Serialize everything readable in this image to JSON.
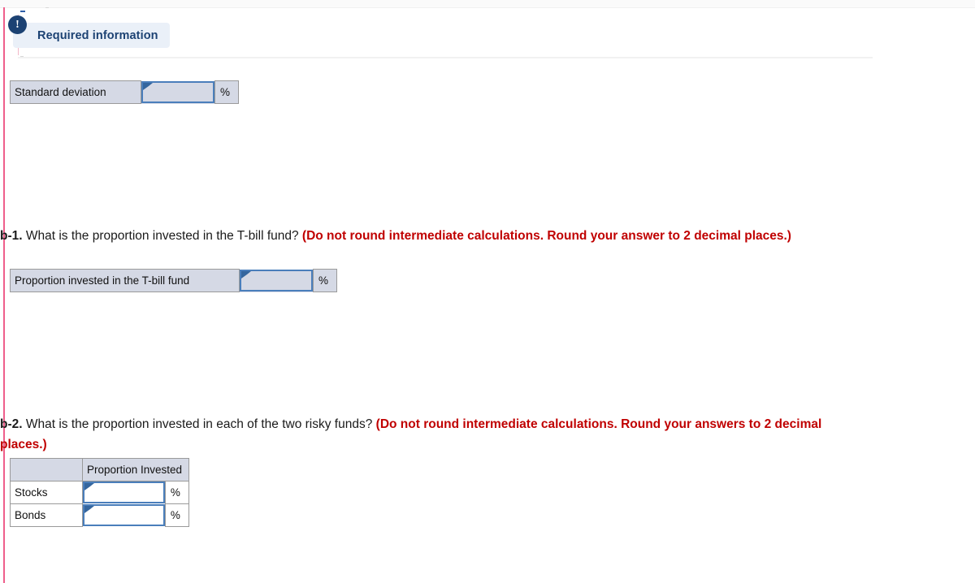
{
  "banner": {
    "icon": "exclamation-icon",
    "icon_glyph": "!",
    "label": "Required information"
  },
  "colors": {
    "accent_navy": "#1c4273",
    "banner_bg": "#eaf0f8",
    "note_red": "#c00000",
    "input_border": "#4a7ebb",
    "input_fill": "#d5d9e5",
    "left_rule_pink": "#ef5f8b"
  },
  "sections": [
    {
      "id": "std-dev",
      "table": {
        "label": "Standard deviation",
        "input_value": "",
        "unit": "%"
      }
    },
    {
      "id": "b-1",
      "question": {
        "number": "b-1.",
        "text": " What is the proportion invested in the T-bill fund? ",
        "note": "(Do not round intermediate calculations. Round your answer to 2 decimal places.)"
      },
      "table": {
        "label": "Proportion invested in the T-bill fund",
        "input_value": "",
        "unit": "%"
      }
    },
    {
      "id": "b-2",
      "question": {
        "number": "b-2.",
        "text": " What is the proportion invested in each of the two risky funds? ",
        "note": "(Do not round intermediate calculations. Round your answers to 2 decimal places.)"
      },
      "table": {
        "corner_header": "",
        "column_header": "Proportion Invested",
        "rows": [
          {
            "label": "Stocks",
            "input_value": "",
            "unit": "%"
          },
          {
            "label": "Bonds",
            "input_value": "",
            "unit": "%"
          }
        ]
      }
    }
  ]
}
